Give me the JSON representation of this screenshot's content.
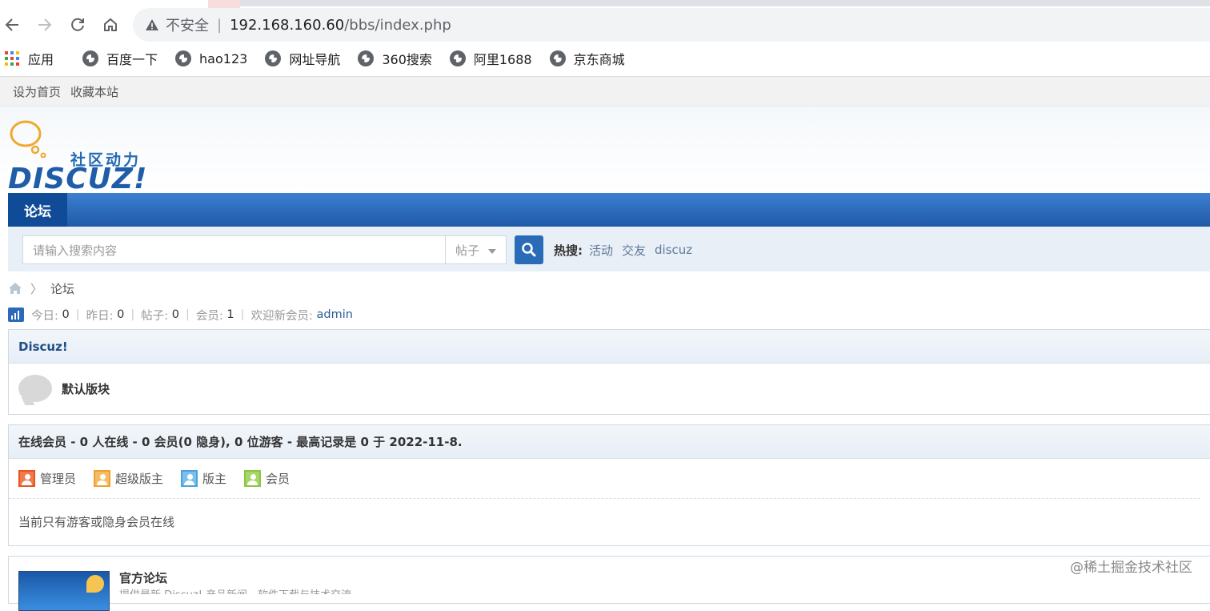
{
  "browser": {
    "insecure_label": "不安全",
    "url_host": "192.168.160.60",
    "url_path": "/bbs/index.php",
    "bookmarks": [
      "应用",
      "百度一下",
      "hao123",
      "网址导航",
      "360搜索",
      "阿里1688",
      "京东商城"
    ]
  },
  "topbar": {
    "set_home": "设为首页",
    "bookmark_site": "收藏本站"
  },
  "logo": {
    "cn": "社区动力",
    "en": "DISCUZ!"
  },
  "nav": {
    "forum_tab": "论坛"
  },
  "search": {
    "placeholder": "请输入搜索内容",
    "type": "帖子",
    "hot_label": "热搜:",
    "hot_terms": [
      "活动",
      "交友",
      "discuz"
    ]
  },
  "breadcrumb": {
    "current": "论坛"
  },
  "stats": {
    "today_label": "今日:",
    "today": "0",
    "yesterday_label": "昨日:",
    "yesterday": "0",
    "posts_label": "帖子:",
    "posts": "0",
    "members_label": "会员:",
    "members": "1",
    "welcome_label": "欢迎新会员:",
    "newest_member": "admin"
  },
  "category": {
    "title": "Discuz!",
    "forum_name": "默认版块"
  },
  "online": {
    "summary": "在线会员 - 0 人在线 - 0 会员(0 隐身), 0 位游客 - 最高记录是 0 于 2022-11-8.",
    "legend": [
      "管理员",
      "超级版主",
      "版主",
      "会员"
    ],
    "note": "当前只有游客或隐身会员在线"
  },
  "partner": {
    "title": "官方论坛",
    "desc": "提供最新 Discuz! 产品新闻、软件下载与技术交流"
  },
  "watermark": "@稀土掘金技术社区",
  "colors": {
    "nav_blue": "#1f5aa8",
    "admin_icon": "#e8541e",
    "super_mod_icon": "#f0a030",
    "mod_icon": "#4aa3df",
    "member_icon": "#8cc63f"
  }
}
